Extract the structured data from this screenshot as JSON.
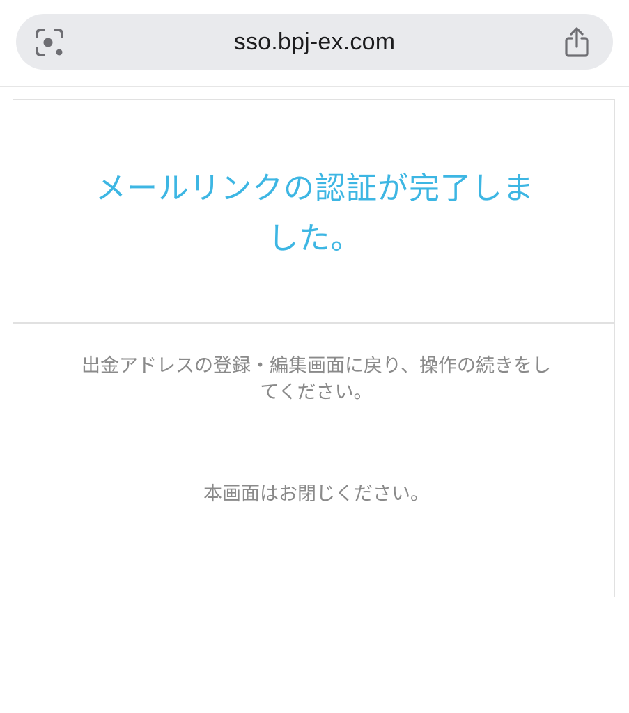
{
  "browser": {
    "url": "sso.bpj-ex.com",
    "left_icon": "visual-search-icon",
    "right_icon": "share-icon"
  },
  "card": {
    "title": "メールリンクの認証が完了しました。",
    "instruction": "出金アドレスの登録・編集画面に戻り、操作の続きをしてください。",
    "close_note": "本画面はお閉じください。"
  },
  "colors": {
    "title": "#3db6e3",
    "body_text": "#8a8a8a",
    "address_bar_bg": "#e9eaed"
  }
}
